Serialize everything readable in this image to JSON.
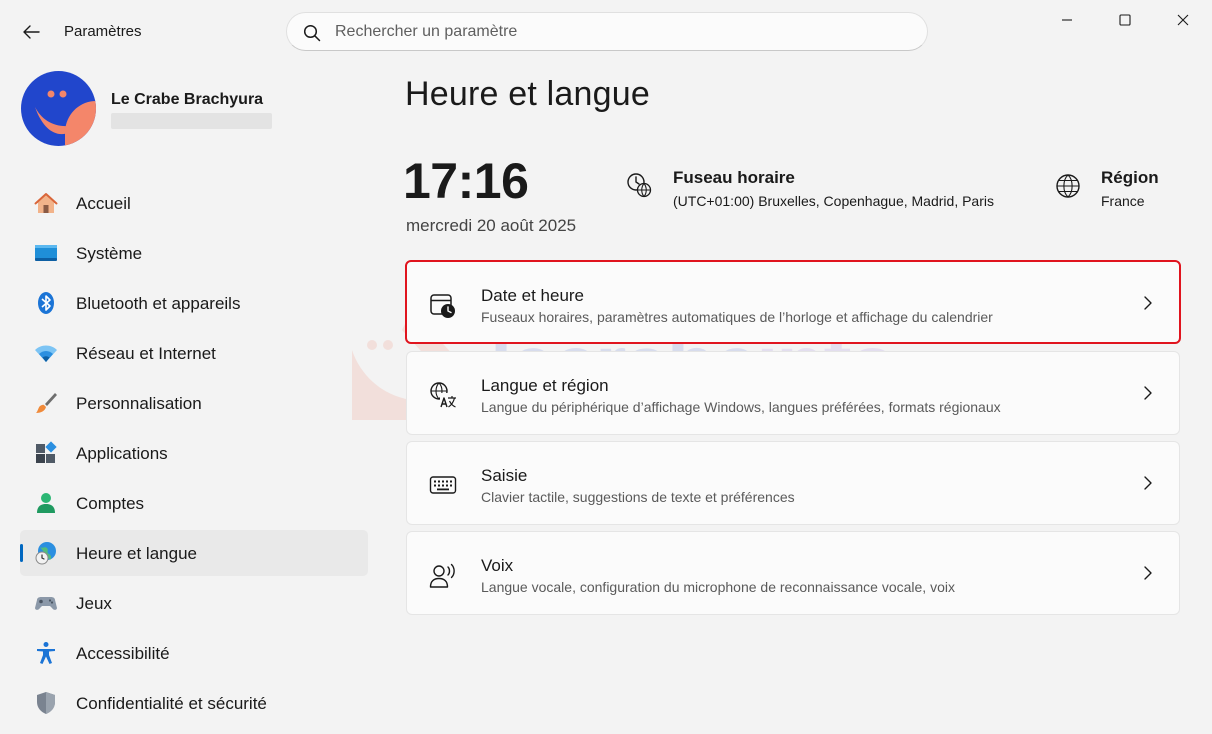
{
  "app": {
    "title": "Paramètres"
  },
  "search": {
    "placeholder": "Rechercher un paramètre"
  },
  "profile": {
    "name": "Le Crabe Brachyura"
  },
  "nav": {
    "items": [
      {
        "label": "Accueil",
        "icon": "home-icon"
      },
      {
        "label": "Système",
        "icon": "monitor-icon"
      },
      {
        "label": "Bluetooth et appareils",
        "icon": "bluetooth-icon"
      },
      {
        "label": "Réseau et Internet",
        "icon": "wifi-icon"
      },
      {
        "label": "Personnalisation",
        "icon": "paintbrush-icon"
      },
      {
        "label": "Applications",
        "icon": "apps-icon"
      },
      {
        "label": "Comptes",
        "icon": "person-icon"
      },
      {
        "label": "Heure et langue",
        "icon": "globe-clock-icon",
        "active": true
      },
      {
        "label": "Jeux",
        "icon": "gamepad-icon"
      },
      {
        "label": "Accessibilité",
        "icon": "accessibility-icon"
      },
      {
        "label": "Confidentialité et sécurité",
        "icon": "shield-icon"
      }
    ]
  },
  "main": {
    "title": "Heure et langue",
    "clock": {
      "time": "17:16",
      "date": "mercredi 20 août 2025"
    },
    "timezone": {
      "title": "Fuseau horaire",
      "value": "(UTC+01:00) Bruxelles, Copenhague, Madrid, Paris"
    },
    "region": {
      "title": "Région",
      "value": "France"
    },
    "cards": [
      {
        "title": "Date et heure",
        "subtitle": "Fuseaux horaires, paramètres automatiques de l’horloge et affichage du calendrier",
        "icon": "calendar-clock-icon"
      },
      {
        "title": "Langue et région",
        "subtitle": "Langue du périphérique d’affichage Windows, langues préférées, formats régionaux",
        "icon": "language-icon"
      },
      {
        "title": "Saisie",
        "subtitle": "Clavier tactile, suggestions de texte et préférences",
        "icon": "keyboard-icon"
      },
      {
        "title": "Voix",
        "subtitle": "Langue vocale, configuration du microphone de reconnaissance vocale, voix",
        "icon": "speech-icon"
      }
    ]
  },
  "watermark": {
    "part1": "lecrabe",
    "part2": "info"
  },
  "colors": {
    "accent": "#0067c0",
    "highlight": "#e0141e",
    "avatar_bg": "#2146cc",
    "avatar_shape": "#f4866a"
  }
}
